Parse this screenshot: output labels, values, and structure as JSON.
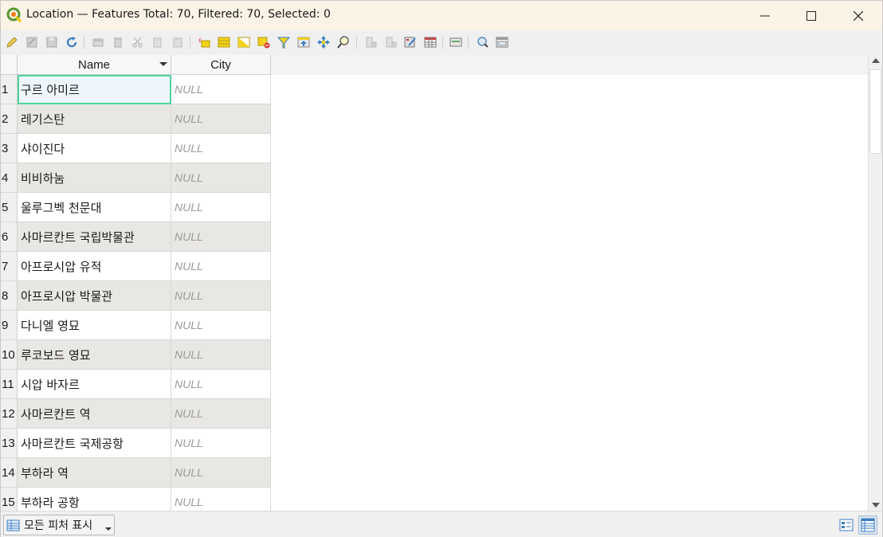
{
  "window": {
    "title": "Location — Features Total: 70, Filtered: 70, Selected: 0",
    "minimize_icon": "minimize-icon",
    "maximize_icon": "maximize-icon",
    "close_icon": "close-icon"
  },
  "toolbar": {
    "buttons": [
      "toggle-editing-icon",
      "multi-edit-icon",
      "save-edits-icon",
      "reload-table-icon",
      "add-feature-icon",
      "delete-selected-icon",
      "cut-icon",
      "copy-icon",
      "paste-icon",
      "select-by-expression-icon",
      "select-all-icon",
      "invert-selection-icon",
      "deselect-all-icon",
      "filter-select-icon",
      "move-selection-to-top-icon",
      "pan-to-selected-icon",
      "zoom-to-selected-icon",
      "new-field-icon",
      "delete-field-icon",
      "field-calculator-icon",
      "conditional-formatting-icon",
      "actions-icon",
      "dock-table-icon",
      "organize-columns-icon"
    ]
  },
  "table": {
    "columns": [
      {
        "label": "Name",
        "sorted": "descending"
      },
      {
        "label": "City"
      }
    ],
    "focused_row": 1,
    "rows": [
      {
        "num": "1",
        "name": "구르 아미르",
        "city": "NULL"
      },
      {
        "num": "2",
        "name": "레기스탄",
        "city": "NULL"
      },
      {
        "num": "3",
        "name": "샤이진다",
        "city": "NULL"
      },
      {
        "num": "4",
        "name": "비비하눔",
        "city": "NULL"
      },
      {
        "num": "5",
        "name": "울루그벡 천문대",
        "city": "NULL"
      },
      {
        "num": "6",
        "name": "사마르칸트 국립박물관",
        "city": "NULL"
      },
      {
        "num": "7",
        "name": "아프로시압 유적",
        "city": "NULL"
      },
      {
        "num": "8",
        "name": "아프로시압 박물관",
        "city": "NULL"
      },
      {
        "num": "9",
        "name": "다니엘 영묘",
        "city": "NULL"
      },
      {
        "num": "10",
        "name": "루코보드 영묘",
        "city": "NULL"
      },
      {
        "num": "11",
        "name": "시압 바자르",
        "city": "NULL"
      },
      {
        "num": "12",
        "name": "사마르칸트 역",
        "city": "NULL"
      },
      {
        "num": "13",
        "name": "사마르칸트 국제공항",
        "city": "NULL"
      },
      {
        "num": "14",
        "name": "부하라 역",
        "city": "NULL"
      },
      {
        "num": "15",
        "name": "부하라 공항",
        "city": "NULL"
      }
    ]
  },
  "bottombar": {
    "filter_label": "모든 피처 표시",
    "form_view_icon": "form-view-icon",
    "table_view_icon": "table-view-icon"
  },
  "colors": {
    "title_bg": "#faf3e6",
    "focus_outline": "#4fd49a",
    "alt_row": "#e9e7e3",
    "null_text": "#9a9a9a"
  }
}
